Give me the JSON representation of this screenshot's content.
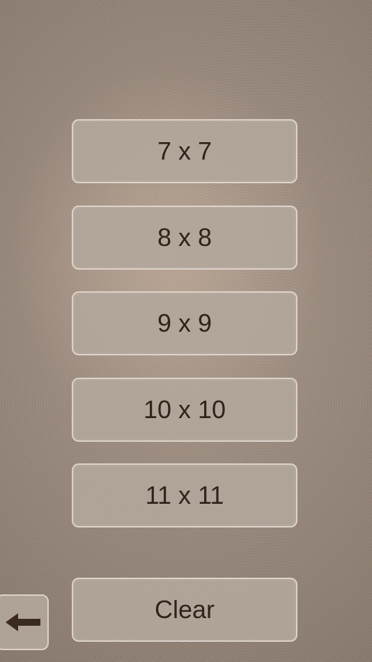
{
  "grid_sizes": [
    {
      "label": "7 x 7"
    },
    {
      "label": "8 x 8"
    },
    {
      "label": "9 x 9"
    },
    {
      "label": "10 x 10"
    },
    {
      "label": "11 x 11"
    }
  ],
  "actions": {
    "clear_label": "Clear",
    "back_icon": "arrow-left-icon"
  },
  "colors": {
    "button_fill": "#b2a69a",
    "button_border": "#ddd3ca",
    "text": "#2e241c",
    "arrow": "#3b2a20"
  }
}
